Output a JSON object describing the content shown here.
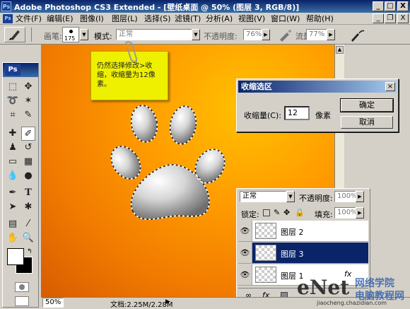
{
  "titlebar": {
    "logo": "Ps",
    "title": "Adobe Photoshop CS3 Extended - [壁纸桌面 @ 50% (图层 3, RGB/8)]",
    "min": "_",
    "max": "□",
    "close": "X",
    "doc_min": "_",
    "doc_restore": "❐",
    "doc_close": "X"
  },
  "menu": [
    "文件(F)",
    "编辑(E)",
    "图像(I)",
    "图层(L)",
    "选择(S)",
    "滤镜(T)",
    "分析(A)",
    "视图(V)",
    "窗口(W)",
    "帮助(H)"
  ],
  "options": {
    "brush_label": "画笔:",
    "brush_size": "175",
    "mode_label": "模式:",
    "mode_value": "正常",
    "opacity_label": "不透明度:",
    "opacity_value": "76%",
    "flow_label": "流量:",
    "flow_value": "77%"
  },
  "toolbox": {
    "logo": "Ps"
  },
  "note": {
    "text": "仍然选择修改>收缩，收缩量为12像素。"
  },
  "dialog": {
    "title": "收缩选区",
    "field_label": "收缩量(C):",
    "field_value": "12",
    "unit": "像素",
    "ok": "确定",
    "cancel": "取消",
    "close": "×"
  },
  "layers": {
    "blend_mode": "正常",
    "opacity_label": "不透明度:",
    "opacity_value": "100%",
    "lock_label": "锁定:",
    "fill_label": "填充:",
    "fill_value": "100%",
    "items": [
      {
        "name": "图层 2",
        "selected": false
      },
      {
        "name": "图层 3",
        "selected": true
      },
      {
        "name": "图层 1",
        "selected": false
      }
    ],
    "fx": "fx"
  },
  "status": {
    "zoom": "50%",
    "doc_info": "文档:2.25M/2.28M"
  },
  "watermark": {
    "logo": "eNet",
    "line1": "网络学院",
    "line2": "电脑教程网",
    "url": "jiaocheng.chazidian.com"
  }
}
